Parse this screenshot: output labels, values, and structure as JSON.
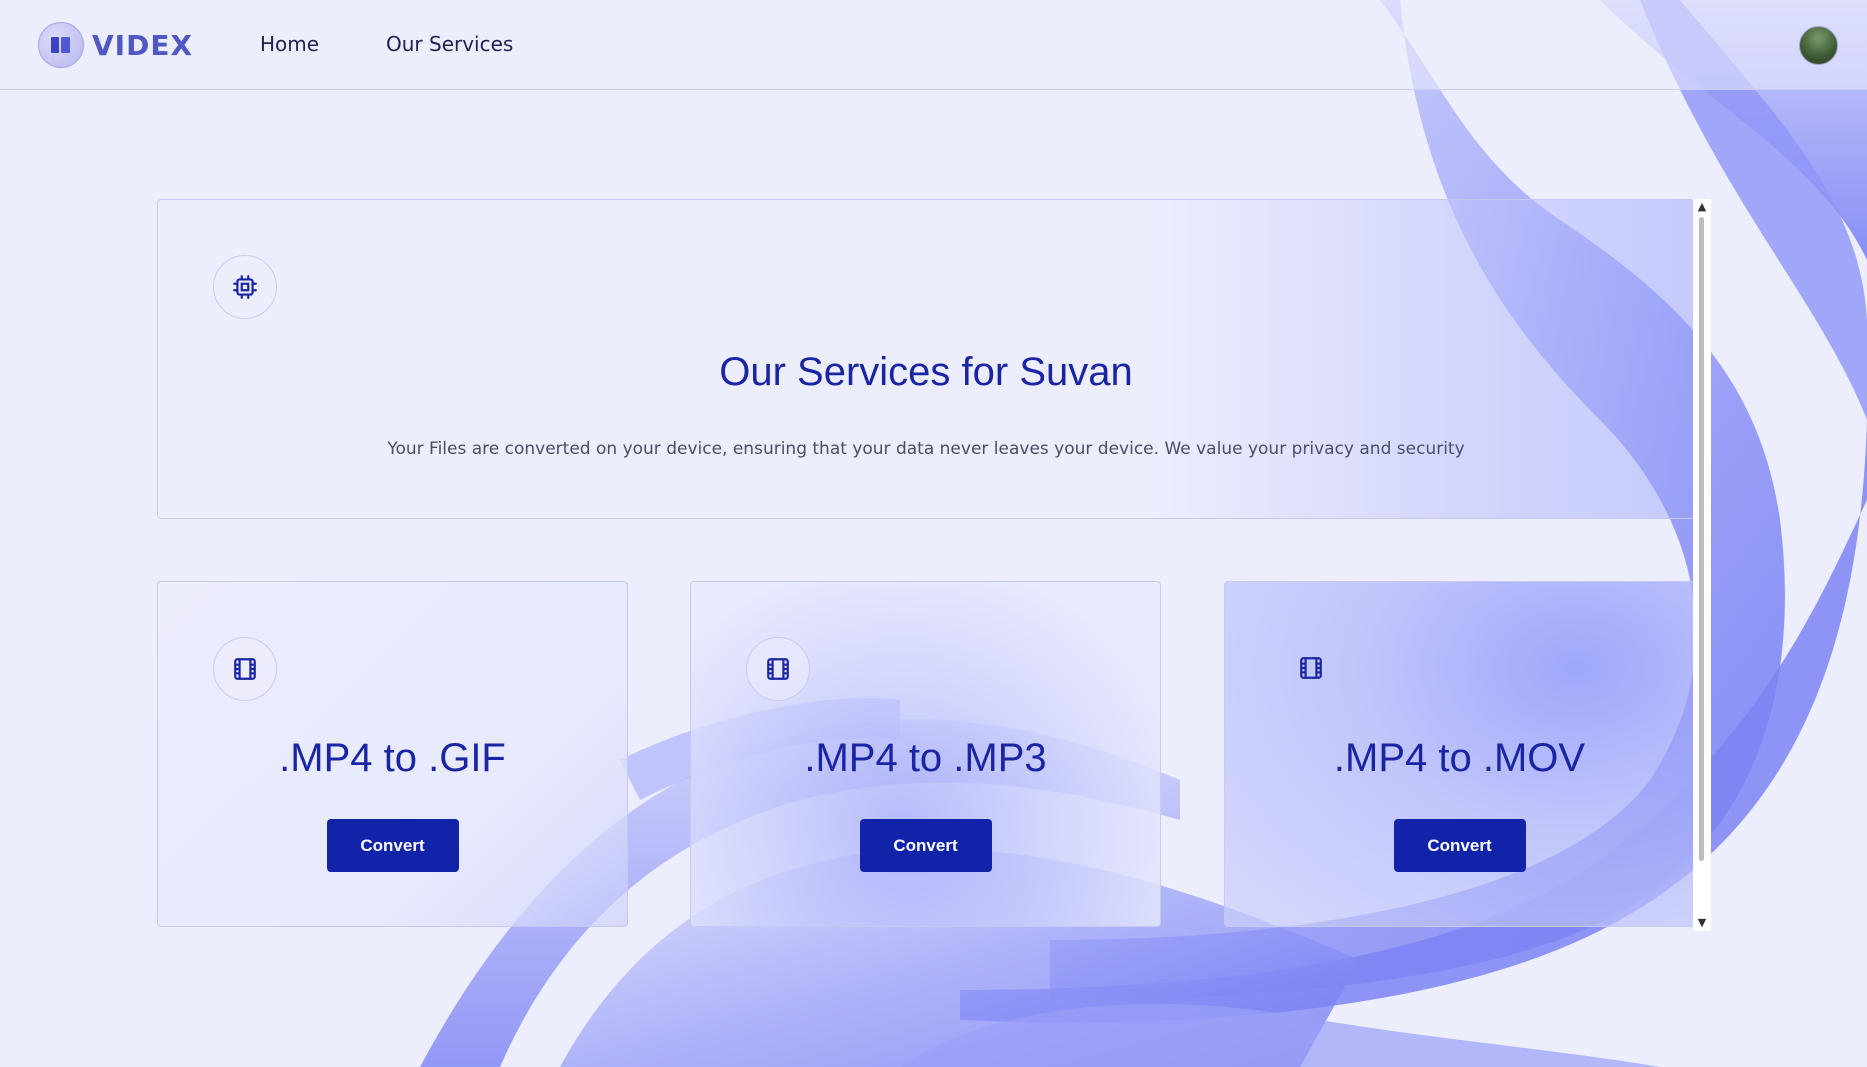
{
  "brand": {
    "name": "VIDEX"
  },
  "nav": {
    "home": "Home",
    "services": "Our Services"
  },
  "hero": {
    "title": "Our Services for Suvan",
    "subtitle": "Your Files are converted on your device, ensuring that your data never leaves your device. We value your privacy and security",
    "icon": "cpu-chip-icon"
  },
  "services": [
    {
      "title": ".MP4 to .GIF",
      "button": "Convert",
      "icon": "film-icon"
    },
    {
      "title": ".MP4 to .MP3",
      "button": "Convert",
      "icon": "film-icon"
    },
    {
      "title": ".MP4 to .MOV",
      "button": "Convert",
      "icon": "film-icon"
    }
  ],
  "colors": {
    "accent": "#1123a8",
    "heading": "#1a25a3",
    "background": "#ecedfd",
    "wave": "#7f86f5"
  }
}
